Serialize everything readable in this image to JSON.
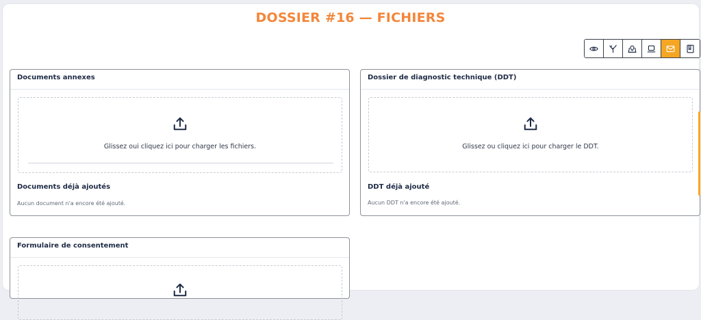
{
  "page": {
    "title": "DOSSIER #16 — FICHIERS"
  },
  "colors": {
    "accent": "#f3863a",
    "active_tool": "#f5a623",
    "text": "#1d2a44"
  },
  "toolbar": {
    "icons": [
      "eye-icon",
      "tree-icon",
      "map-pin-icon",
      "laptop-icon",
      "mail-icon",
      "book-icon"
    ],
    "active_index": 4
  },
  "annexes": {
    "header": "Documents annexes",
    "dropzone_text": "Glissez oui cliquez ici pour charger les fichiers.",
    "added_title": "Documents déjà ajoutés",
    "empty_text": "Aucun document n'a encore été ajouté."
  },
  "ddt": {
    "header": "Dossier de diagnostic technique (DDT)",
    "dropzone_text": "Glissez ou cliquez ici pour charger le DDT.",
    "added_title": "DDT déjà ajouté",
    "empty_text": "Aucun DDT n'a encore été ajouté."
  },
  "consent": {
    "header": "Formulaire de consentement"
  }
}
